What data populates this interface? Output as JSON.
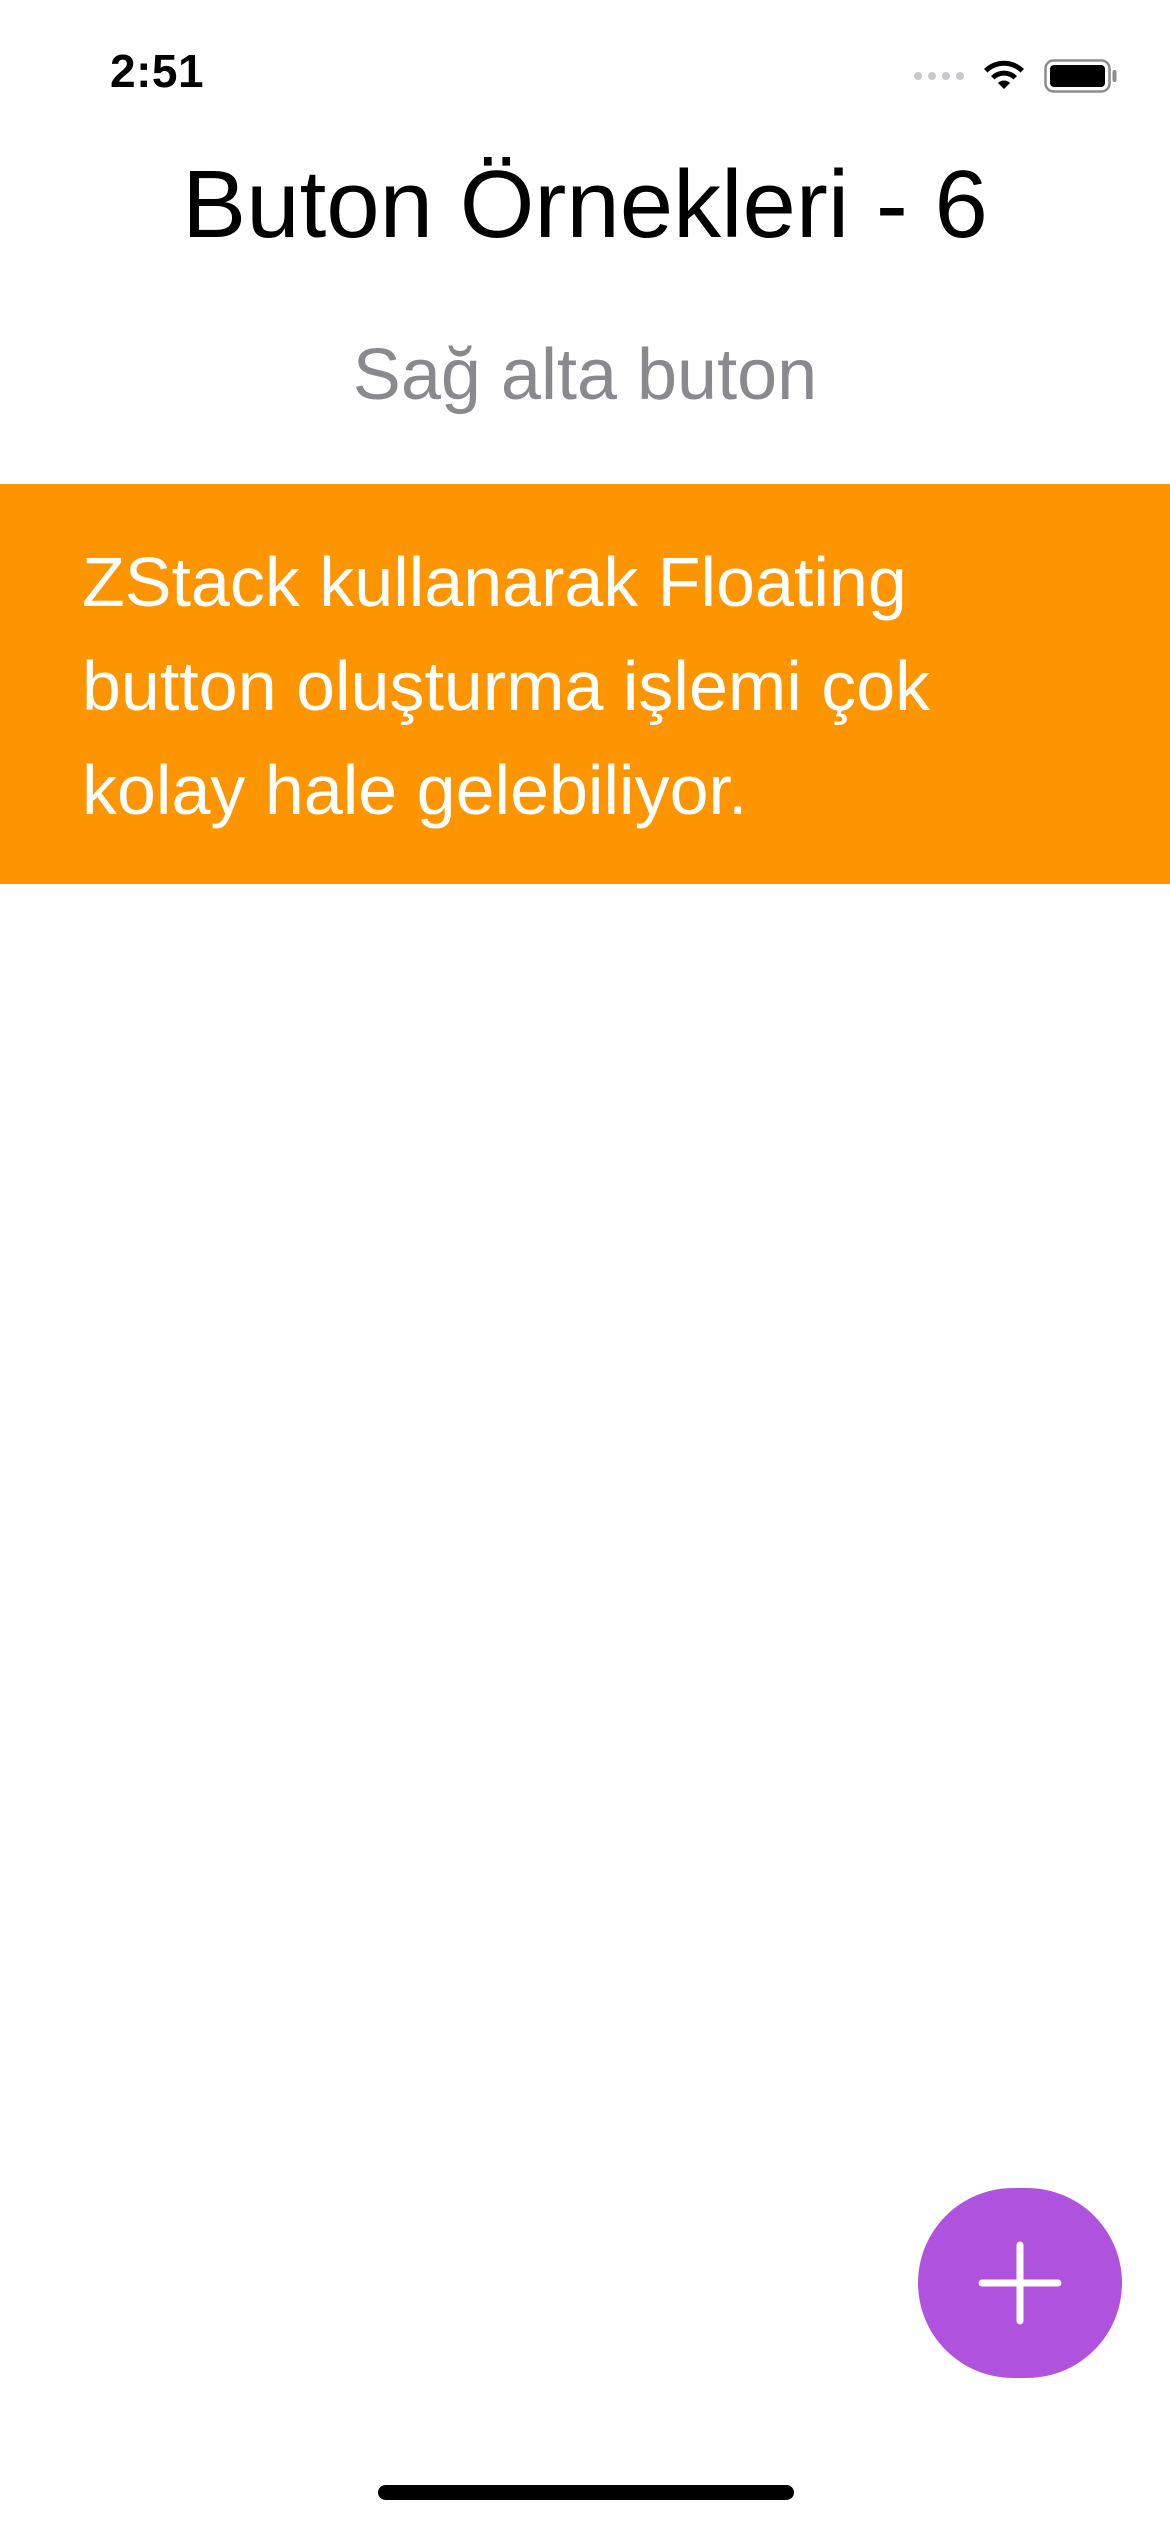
{
  "status_bar": {
    "time": "2:51",
    "icons": [
      "signal-dots-icon",
      "wifi-icon",
      "battery-icon"
    ]
  },
  "header": {
    "title": "Buton Örnekleri - 6",
    "subtitle": "Sağ alta buton"
  },
  "banner": {
    "text": "ZStack kullanarak Floating button oluşturma işlemi çok kolay hale gelebiliyor.",
    "background_color": "#fd9500",
    "text_color": "#ffffff"
  },
  "fab": {
    "icon": "plus-icon",
    "background_color": "#af52de"
  }
}
